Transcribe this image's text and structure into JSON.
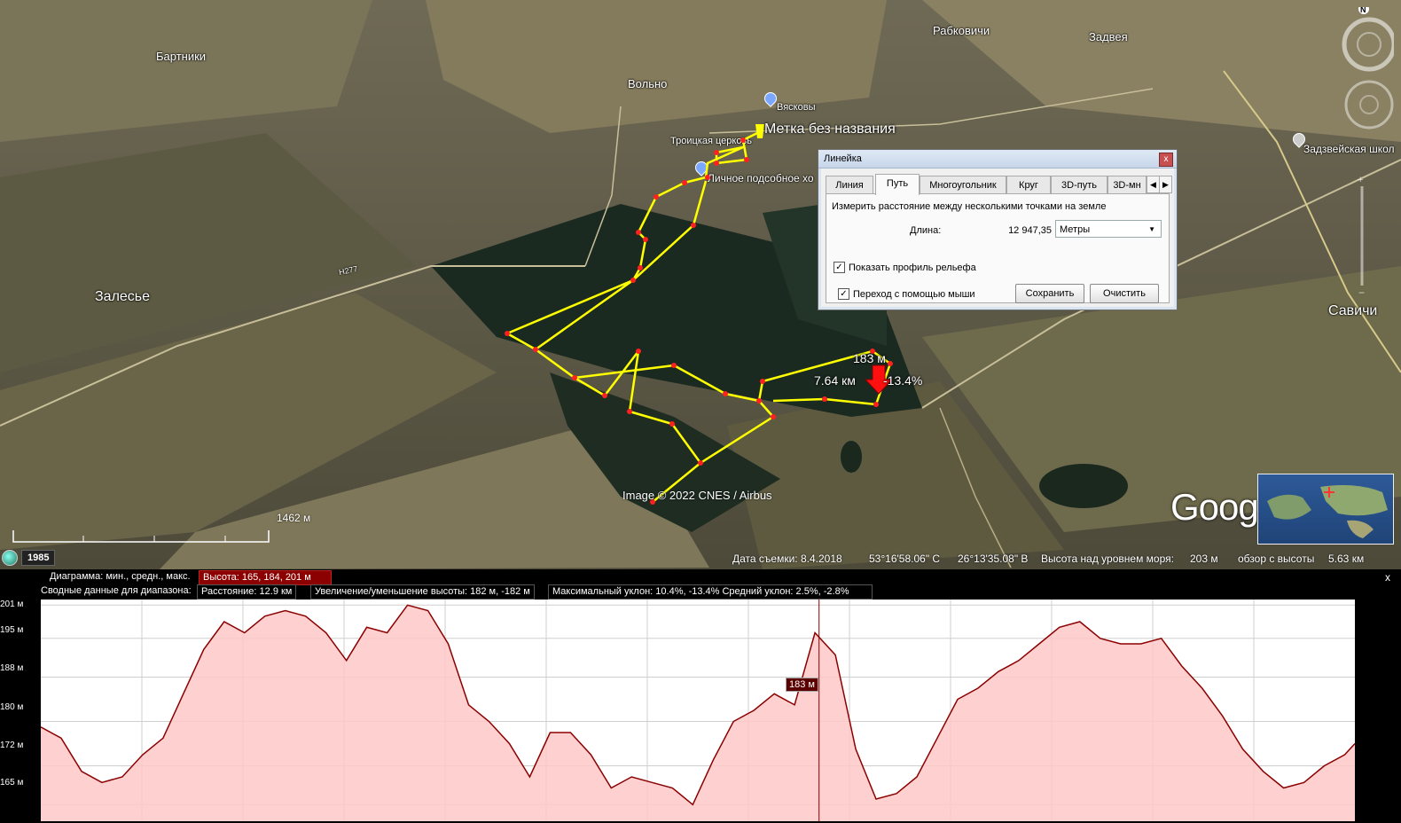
{
  "map": {
    "places": [
      {
        "name": "Бартники"
      },
      {
        "name": "Вольно"
      },
      {
        "name": "Рабковичи"
      },
      {
        "name": "Задвея"
      },
      {
        "name": "Вясковы"
      },
      {
        "name": "Троицкая церковь"
      },
      {
        "name": "Личное подсобное хо"
      },
      {
        "name": "Залесье"
      },
      {
        "name": "Задзвейская школ"
      },
      {
        "name": "Савичи"
      }
    ],
    "road_labels": [
      "Н277"
    ],
    "placemark_label": "Метка без названия",
    "route_distance": "7.64 км",
    "route_elevation": "183 м",
    "route_slope": "-13.4%",
    "copyright": "Image © 2022 CNES / Airbus",
    "scale_label": "1462 м",
    "historical_year": "1985",
    "compass_letter": "N",
    "logo": "Google Earth",
    "colors": {
      "route": "#ffff00",
      "route_point": "#ff2020",
      "profile_line": "#8b0000",
      "profile_fill": "#ffc8c8"
    }
  },
  "status_bar": {
    "date": "Дата съемки: 8.4.2018",
    "lat": "53°16'58.06\" С",
    "lon": "26°13'35.08\" В",
    "elevation": "Высота над уровнем моря:",
    "elevation_value": "203 м",
    "eye": "обзор с высоты",
    "eye_value": "5.63 км"
  },
  "ruler": {
    "title": "Линейка",
    "close": "x",
    "tabs": [
      "Линия",
      "Путь",
      "Многоугольник",
      "Круг",
      "3D-путь",
      "3D-мн"
    ],
    "active_tab": "Путь",
    "description": "Измерить расстояние между несколькими точками на земле",
    "length_label": "Длина:",
    "length_value": "12 947,35",
    "unit": "Метры",
    "show_profile": "Показать профиль рельефа",
    "mouse_nav": "Переход с помощью мыши",
    "save": "Сохранить",
    "clear": "Очистить"
  },
  "profile": {
    "row1_label": "Диаграмма: мин., средн., макс.",
    "row1_value": "Высота: 165, 184, 201 м",
    "row2_label": "Сводные данные для диапазона:",
    "row2_distance": "Расстояние: 12.9 км",
    "row2_gain": "Увеличение/уменьшение высоты: 182 м, -182 м",
    "row2_slope": "Максимальный уклон: 10.4%, -13.4% Средний уклон: 2.5%, -2.8%",
    "cursor_label": "183 м",
    "y_ticks": [
      "201 м",
      "195 м",
      "188 м",
      "180 м",
      "172 м",
      "165 м"
    ],
    "close": "x"
  },
  "chart_data": {
    "type": "area",
    "xlabel": "",
    "ylabel": "",
    "ylim": [
      162,
      202
    ],
    "x_range_km": [
      0,
      12.9
    ],
    "series": [
      {
        "name": "Высота",
        "x": [
          0,
          0.2,
          0.4,
          0.6,
          0.8,
          1.0,
          1.2,
          1.4,
          1.6,
          1.8,
          2.0,
          2.2,
          2.4,
          2.6,
          2.8,
          3.0,
          3.2,
          3.4,
          3.6,
          3.8,
          4.0,
          4.2,
          4.4,
          4.6,
          4.8,
          5.0,
          5.2,
          5.4,
          5.6,
          5.8,
          6.0,
          6.2,
          6.4,
          6.6,
          6.8,
          7.0,
          7.2,
          7.4,
          7.6,
          7.8,
          8.0,
          8.2,
          8.4,
          8.6,
          8.8,
          9.0,
          9.2,
          9.4,
          9.6,
          9.8,
          10.0,
          10.2,
          10.4,
          10.6,
          10.8,
          11.0,
          11.2,
          11.4,
          11.6,
          11.8,
          12.0,
          12.2,
          12.4,
          12.6,
          12.8,
          12.9
        ],
        "values": [
          179,
          177,
          171,
          169,
          170,
          174,
          177,
          185,
          193,
          198,
          196,
          199,
          200,
          199,
          196,
          191,
          197,
          196,
          201,
          200,
          194,
          183,
          180,
          176,
          170,
          178,
          178,
          174,
          168,
          170,
          169,
          168,
          165,
          173,
          180,
          182,
          185,
          183,
          196,
          192,
          175,
          166,
          167,
          170,
          177,
          184,
          186,
          189,
          191,
          194,
          197,
          198,
          195,
          194,
          194,
          195,
          190,
          186,
          181,
          175,
          171,
          168,
          169,
          172,
          174,
          176
        ]
      }
    ]
  }
}
